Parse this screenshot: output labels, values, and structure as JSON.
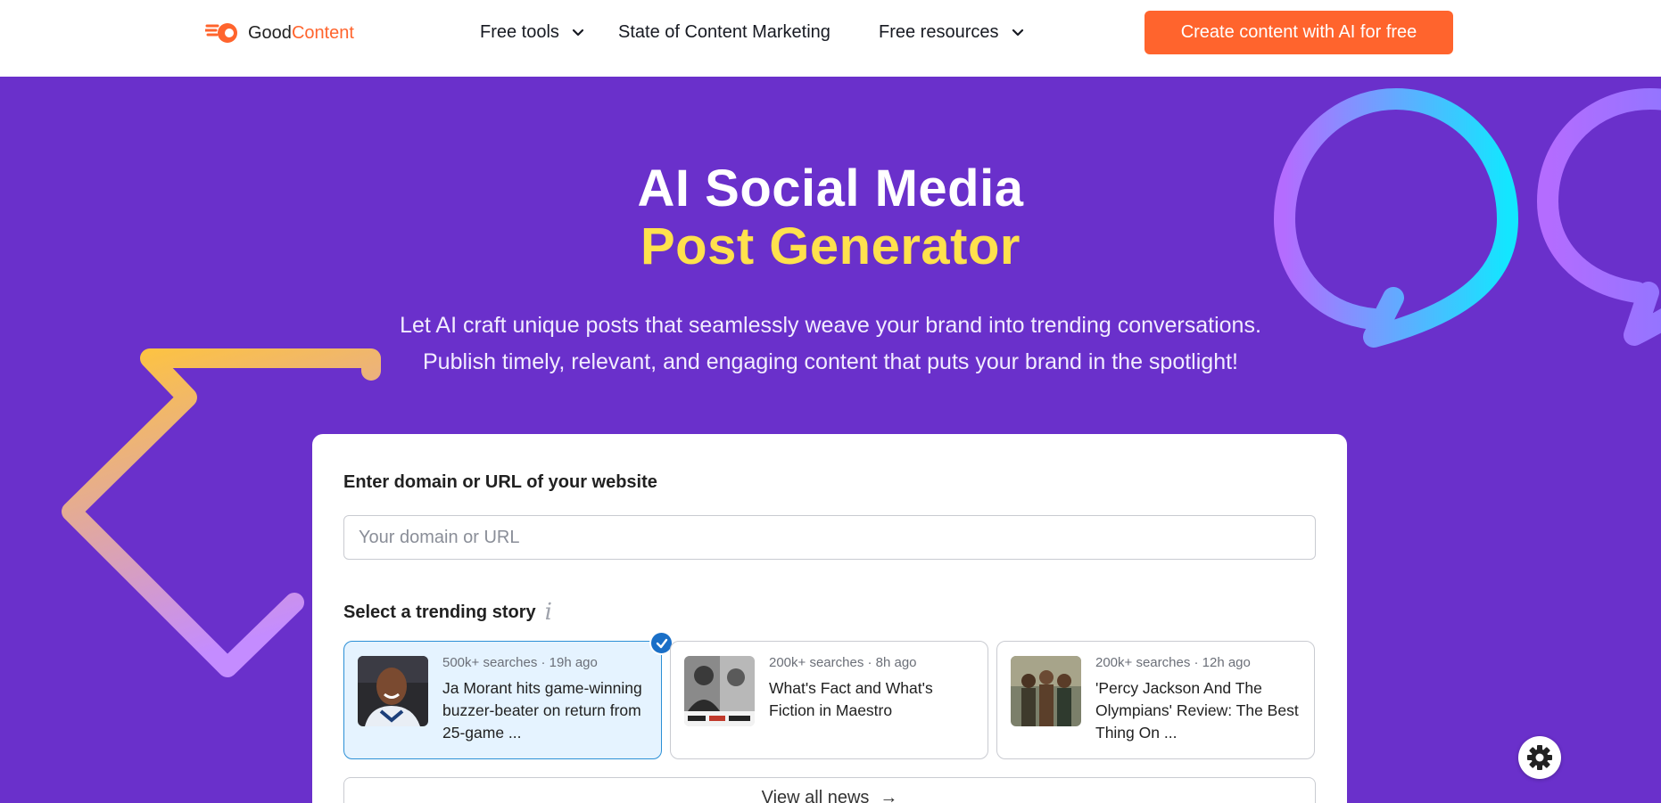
{
  "header": {
    "logo_text_primary": "Good",
    "logo_text_accent": "Content",
    "nav": {
      "free_tools": "Free tools",
      "state_of_content": "State of Content Marketing",
      "free_resources": "Free resources"
    },
    "cta_label": "Create content with AI for free"
  },
  "hero": {
    "title_line1": "AI Social Media",
    "title_line2": "Post Generator",
    "subtitle_line1": "Let AI craft unique posts that seamlessly weave your brand into trending conversations.",
    "subtitle_line2": "Publish timely, relevant, and engaging content that puts your brand in the spotlight!"
  },
  "form": {
    "domain_label": "Enter domain or URL of your website",
    "domain_placeholder": "Your domain or URL",
    "domain_value": "",
    "story_label": "Select a trending story",
    "info_icon": "i",
    "stories": [
      {
        "meta": "500k+ searches · 19h ago",
        "headline": "Ja Morant hits game-winning buzzer-beater on return from 25-game ...",
        "selected": true
      },
      {
        "meta": "200k+ searches · 8h ago",
        "headline": "What's Fact and What's Fiction in Maestro",
        "selected": false
      },
      {
        "meta": "200k+ searches · 12h ago",
        "headline": "'Percy Jackson And The Olympians' Review: The Best Thing On ...",
        "selected": false
      }
    ],
    "view_all_label": "View all news",
    "view_all_arrow": "→"
  },
  "colors": {
    "brand_orange": "#ff642d",
    "hero_purple": "#6a30cb",
    "title_yellow": "#ffe14d",
    "selected_bg": "#e5f3ff",
    "check_blue": "#1a6fc7"
  },
  "icons": {
    "logo": "rocket-flame-icon",
    "nav_chevron": "chevron-down-icon",
    "selected_check": "check-icon",
    "settings": "gear-icon",
    "arrow": "arrow-right-icon"
  }
}
